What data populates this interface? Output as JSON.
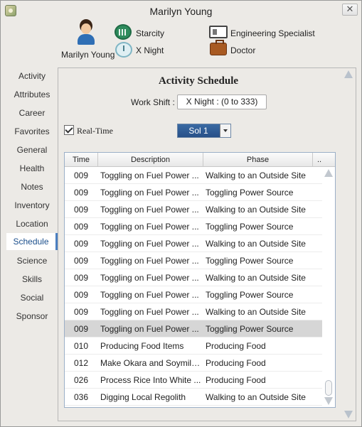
{
  "window": {
    "title": "Marilyn Young"
  },
  "profile": {
    "name": "Marilyn Young",
    "settlement": "Starcity",
    "shift": "X Night",
    "job": "Engineering Specialist",
    "role": "Doctor"
  },
  "sidebar": {
    "items": [
      {
        "label": "Activity",
        "active": false
      },
      {
        "label": "Attributes",
        "active": false
      },
      {
        "label": "Career",
        "active": false
      },
      {
        "label": "Favorites",
        "active": false
      },
      {
        "label": "General",
        "active": false
      },
      {
        "label": "Health",
        "active": false
      },
      {
        "label": "Notes",
        "active": false
      },
      {
        "label": "Inventory",
        "active": false
      },
      {
        "label": "Location",
        "active": false
      },
      {
        "label": "Schedule",
        "active": true
      },
      {
        "label": "Science",
        "active": false
      },
      {
        "label": "Skills",
        "active": false
      },
      {
        "label": "Social",
        "active": false
      },
      {
        "label": "Sponsor",
        "active": false
      }
    ]
  },
  "schedule": {
    "title": "Activity Schedule",
    "work_shift_label": "Work Shift :",
    "work_shift_value": "X Night : (0 to 333)",
    "realtime_label": "Real-Time",
    "realtime_checked": true,
    "sol_value": "Sol 1",
    "columns": [
      "Time",
      "Description",
      "Phase",
      ".."
    ],
    "rows": [
      {
        "time": "009",
        "description": "Toggling on Fuel Power ...",
        "phase": "Walking to an Outside Site",
        "selected": false
      },
      {
        "time": "009",
        "description": "Toggling on Fuel Power ...",
        "phase": "Toggling Power Source",
        "selected": false
      },
      {
        "time": "009",
        "description": "Toggling on Fuel Power ...",
        "phase": "Walking to an Outside Site",
        "selected": false
      },
      {
        "time": "009",
        "description": "Toggling on Fuel Power ...",
        "phase": "Toggling Power Source",
        "selected": false
      },
      {
        "time": "009",
        "description": "Toggling on Fuel Power ...",
        "phase": "Walking to an Outside Site",
        "selected": false
      },
      {
        "time": "009",
        "description": "Toggling on Fuel Power ...",
        "phase": "Toggling Power Source",
        "selected": false
      },
      {
        "time": "009",
        "description": "Toggling on Fuel Power ...",
        "phase": "Walking to an Outside Site",
        "selected": false
      },
      {
        "time": "009",
        "description": "Toggling on Fuel Power ...",
        "phase": "Toggling Power Source",
        "selected": false
      },
      {
        "time": "009",
        "description": "Toggling on Fuel Power ...",
        "phase": "Walking to an Outside Site",
        "selected": false
      },
      {
        "time": "009",
        "description": "Toggling on Fuel Power ...",
        "phase": "Toggling Power Source",
        "selected": true
      },
      {
        "time": "010",
        "description": "Producing Food Items",
        "phase": "Producing Food",
        "selected": false
      },
      {
        "time": "012",
        "description": "Make Okara and Soymilk...",
        "phase": "Producing Food",
        "selected": false
      },
      {
        "time": "026",
        "description": "Process Rice Into White ...",
        "phase": "Producing Food",
        "selected": false
      },
      {
        "time": "036",
        "description": "Digging Local Regolith",
        "phase": "Walking to an Outside Site",
        "selected": false
      }
    ]
  },
  "colors": {
    "accent": "#4b7fc1",
    "sol_button": "#285088",
    "selected_row": "#d6d6d6"
  }
}
